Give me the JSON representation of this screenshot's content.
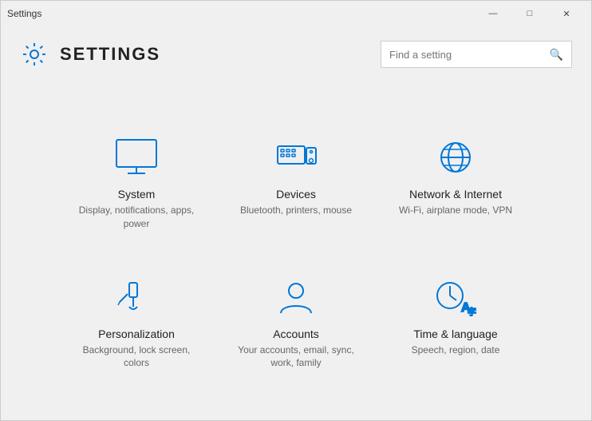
{
  "window": {
    "title": "Settings",
    "controls": {
      "minimize": "—",
      "maximize": "□",
      "close": "✕"
    }
  },
  "header": {
    "title": "SETTINGS",
    "search_placeholder": "Find a setting"
  },
  "grid": {
    "items": [
      {
        "id": "system",
        "title": "System",
        "description": "Display, notifications, apps, power",
        "icon": "monitor"
      },
      {
        "id": "devices",
        "title": "Devices",
        "description": "Bluetooth, printers, mouse",
        "icon": "devices"
      },
      {
        "id": "network",
        "title": "Network & Internet",
        "description": "Wi-Fi, airplane mode, VPN",
        "icon": "globe"
      },
      {
        "id": "personalization",
        "title": "Personalization",
        "description": "Background, lock screen, colors",
        "icon": "brush"
      },
      {
        "id": "accounts",
        "title": "Accounts",
        "description": "Your accounts, email, sync, work, family",
        "icon": "person"
      },
      {
        "id": "time",
        "title": "Time & language",
        "description": "Speech, region, date",
        "icon": "clock"
      }
    ]
  }
}
